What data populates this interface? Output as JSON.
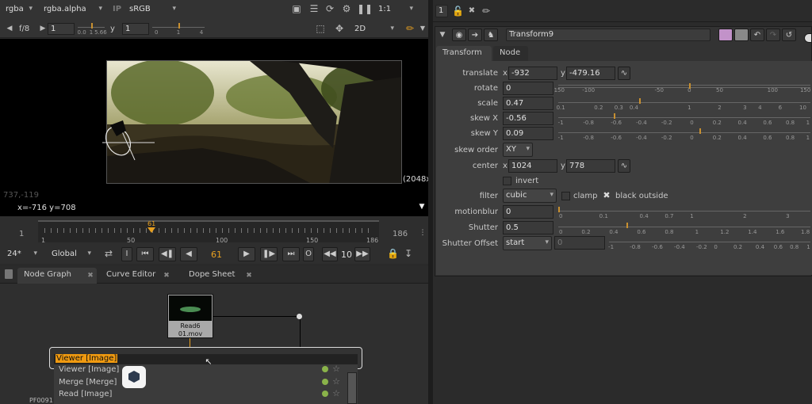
{
  "viewer": {
    "channels": "rgba",
    "alpha_channel": "rgba.alpha",
    "ip_label": "IP",
    "colorspace": "sRGB",
    "zoom": "1:1",
    "fstop": "f/8",
    "gain_value": "1",
    "gain_ticks": [
      "0.0",
      "1",
      "5.66"
    ],
    "y_label": "y",
    "gamma_value": "1",
    "gamma_ticks": [
      "0",
      "1",
      "4"
    ],
    "view_mode": "2D",
    "resolution_label": "(2048x",
    "pixel_coords": "737,-119",
    "cursor_readout": "x=-716 y=708"
  },
  "timeline": {
    "start": "1",
    "end": "186",
    "ticks": [
      "1",
      "50",
      "100",
      "150",
      "186"
    ],
    "current": "61",
    "fps": "24*",
    "scope": "Global",
    "frame_field": "61",
    "increment": "10"
  },
  "transport": {
    "in_label": "I",
    "out_label": "O"
  },
  "tabs": [
    "Node Graph",
    "Curve Editor",
    "Dope Sheet"
  ],
  "node": {
    "name": "Read6",
    "file": "01.mov",
    "tag": "PF0091"
  },
  "search": {
    "query": "Viewer [Image]",
    "results": [
      "Viewer [Image]",
      "Merge [Merge]",
      "Read [Image]"
    ]
  },
  "properties": {
    "panel_count": "1",
    "node_name": "Transform9",
    "tabs": [
      "Transform",
      "Node"
    ],
    "translate": {
      "label": "translate",
      "x_label": "x",
      "x": "-932",
      "y_label": "y",
      "y": "-479.16",
      "ticks": [
        "-150",
        "-100",
        "-50",
        "0",
        "50",
        "100",
        "150"
      ]
    },
    "rotate": {
      "label": "rotate",
      "value": "0",
      "ticks": [
        "-180",
        "-100",
        "-50",
        "0",
        "50",
        "100",
        "150"
      ]
    },
    "scale": {
      "label": "scale",
      "value": "0.47",
      "ticks": [
        "0.1",
        "0.2",
        "0.3",
        "0.4",
        "1",
        "2",
        "3",
        "4",
        "6",
        "10"
      ]
    },
    "skew_x": {
      "label": "skew X",
      "value": "-0.56",
      "ticks": [
        "-1",
        "-0.8",
        "-0.6",
        "-0.4",
        "-0.2",
        "0",
        "0.2",
        "0.4",
        "0.6",
        "0.8",
        "1"
      ]
    },
    "skew_y": {
      "label": "skew Y",
      "value": "0.09",
      "ticks": [
        "-1",
        "-0.8",
        "-0.6",
        "-0.4",
        "-0.2",
        "0",
        "0.2",
        "0.4",
        "0.6",
        "0.8",
        "1"
      ]
    },
    "skew_order": {
      "label": "skew order",
      "value": "XY"
    },
    "center": {
      "label": "center",
      "x_label": "x",
      "x": "1024",
      "y_label": "y",
      "y": "778"
    },
    "invert_label": "invert",
    "filter": {
      "label": "filter",
      "value": "cubic",
      "clamp_label": "clamp",
      "black_outside_label": "black outside"
    },
    "motionblur": {
      "label": "motionblur",
      "value": "0",
      "ticks": [
        "0",
        "0.1",
        "0.4",
        "0.7",
        "1",
        "2",
        "3"
      ]
    },
    "shutter": {
      "label": "Shutter",
      "value": "0.5",
      "ticks": [
        "0",
        "0.2",
        "0.4",
        "0.6",
        "0.8",
        "1",
        "1.2",
        "1.4",
        "1.6",
        "1.8"
      ]
    },
    "shutter_offset": {
      "label": "Shutter Offset",
      "value": "start",
      "custom": "0",
      "ticks": [
        "-1",
        "-0.8",
        "-0.6",
        "-0.4",
        "-0.2",
        "0",
        "0.2",
        "0.4",
        "0.6",
        "0.8",
        "1"
      ]
    }
  }
}
